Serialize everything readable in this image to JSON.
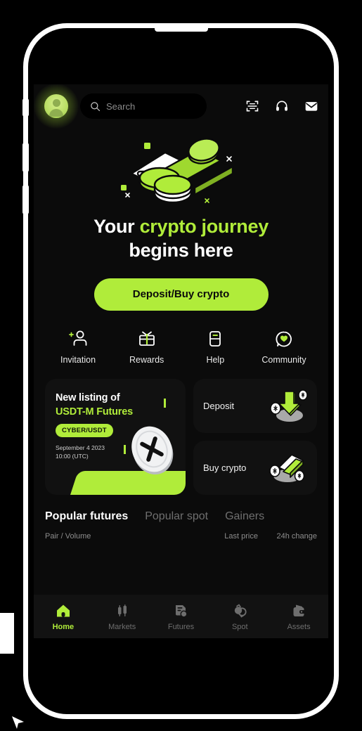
{
  "app": {
    "accent_color": "#b0ec3a",
    "screen_bg": "#0b0b0b",
    "card_bg": "#111111",
    "nav_bg": "#121212"
  },
  "topbar": {
    "avatar_name": "avatar",
    "search": {
      "placeholder": "Search",
      "value": "Search"
    },
    "icons": [
      {
        "name": "scan-code-icon",
        "label": "Scan code"
      },
      {
        "name": "headset-icon",
        "label": "Customer support"
      },
      {
        "name": "mail-icon",
        "label": "Inbox"
      }
    ]
  },
  "hero": {
    "illustration": "crypto-cards-coins-illustration",
    "headline_pre": "Your ",
    "headline_accent": "crypto journey",
    "headline_post": "begins here",
    "cta_label": "Deposit/Buy crypto"
  },
  "quick_actions": [
    {
      "label": "Invitation",
      "icon": "add-person-icon"
    },
    {
      "label": "Rewards",
      "icon": "gift-icon"
    },
    {
      "label": "Help",
      "icon": "book-icon"
    },
    {
      "label": "Community",
      "icon": "chat-heart-icon"
    }
  ],
  "promo": {
    "title_line1": "New listing of",
    "title_line2": "USDT-M Futures",
    "badge": "CYBER/USDT",
    "date_line1": "September 4 2023",
    "date_line2": "10:00 (UTC)",
    "coin_icon": "cyber-coin-icon"
  },
  "side_cards": [
    {
      "label": "Deposit",
      "icon": "deposit-arrow-coins-icon"
    },
    {
      "label": "Buy crypto",
      "icon": "buy-crypto-card-coins-icon"
    }
  ],
  "market": {
    "tabs": [
      {
        "label": "Popular futures",
        "active": true
      },
      {
        "label": "Popular spot",
        "active": false
      },
      {
        "label": "Gainers",
        "active": false
      }
    ],
    "columns": {
      "pair": "Pair / Volume",
      "last_price": "Last price",
      "change": "24h change"
    },
    "rows": []
  },
  "bottom_nav": [
    {
      "label": "Home",
      "icon": "home-icon",
      "active": true
    },
    {
      "label": "Markets",
      "icon": "candlestick-icon",
      "active": false
    },
    {
      "label": "Futures",
      "icon": "futures-doc-icon",
      "active": false
    },
    {
      "label": "Spot",
      "icon": "spot-swap-icon",
      "active": false
    },
    {
      "label": "Assets",
      "icon": "wallet-icon",
      "active": false
    }
  ]
}
